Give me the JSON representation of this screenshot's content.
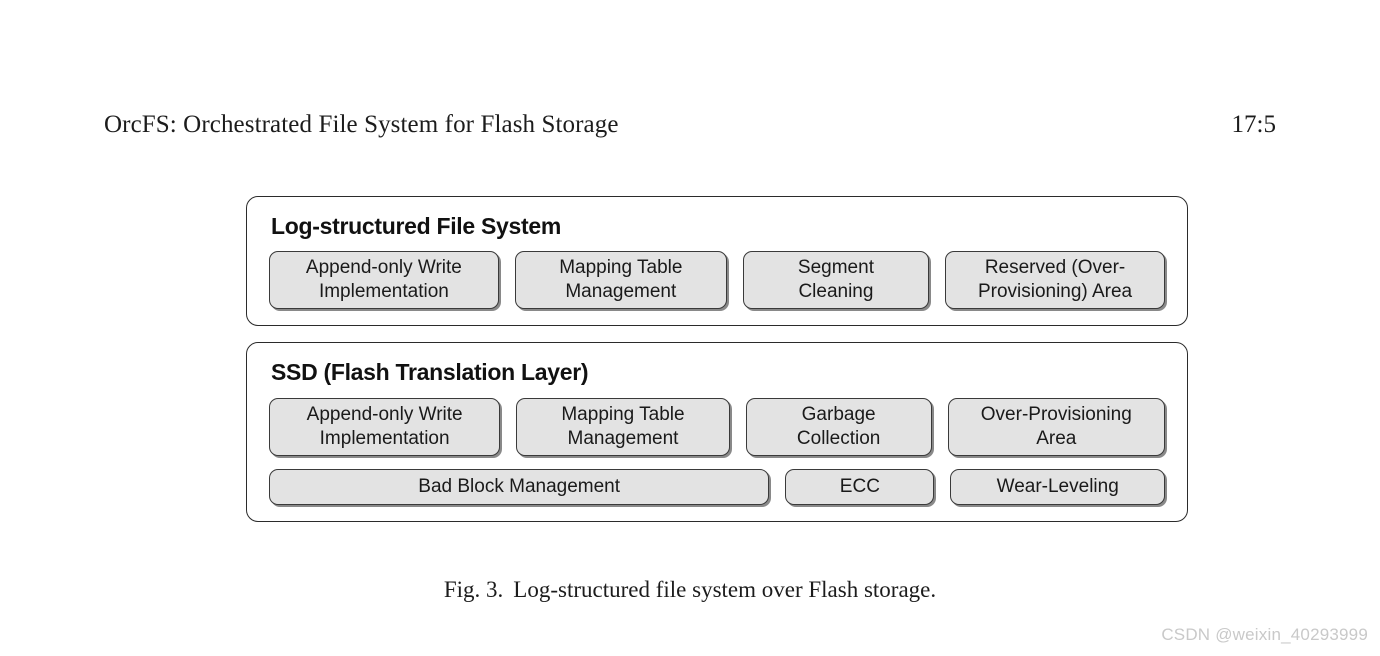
{
  "header": {
    "title": "OrcFS: Orchestrated File System for Flash Storage",
    "folio": "17:5"
  },
  "figure": {
    "panels": [
      {
        "title": "Log-structured File System",
        "rows": [
          {
            "cells": [
              "Append-only Write\nImplementation",
              "Mapping Table\nManagement",
              "Segment\nCleaning",
              "Reserved (Over-\nProvisioning) Area"
            ]
          }
        ]
      },
      {
        "title": "SSD (Flash Translation Layer)",
        "rows": [
          {
            "cells": [
              "Append-only Write\nImplementation",
              "Mapping Table\nManagement",
              "Garbage\nCollection",
              "Over-Provisioning\nArea"
            ]
          },
          {
            "cells": [
              "Bad Block Management",
              "ECC",
              "Wear-Leveling"
            ]
          }
        ]
      }
    ]
  },
  "caption": {
    "label": "Fig. 3.",
    "text": "Log-structured file system over Flash storage."
  },
  "watermark": {
    "text": "CSDN @weixin_40293999"
  },
  "colors": {
    "page_background": "#ffffff",
    "panel_border": "#2b2b2b",
    "cell_fill": "#e3e3e3",
    "cell_border": "#3a3a3a",
    "text": "#1a1a1a",
    "watermark": "#c9c9c9"
  }
}
